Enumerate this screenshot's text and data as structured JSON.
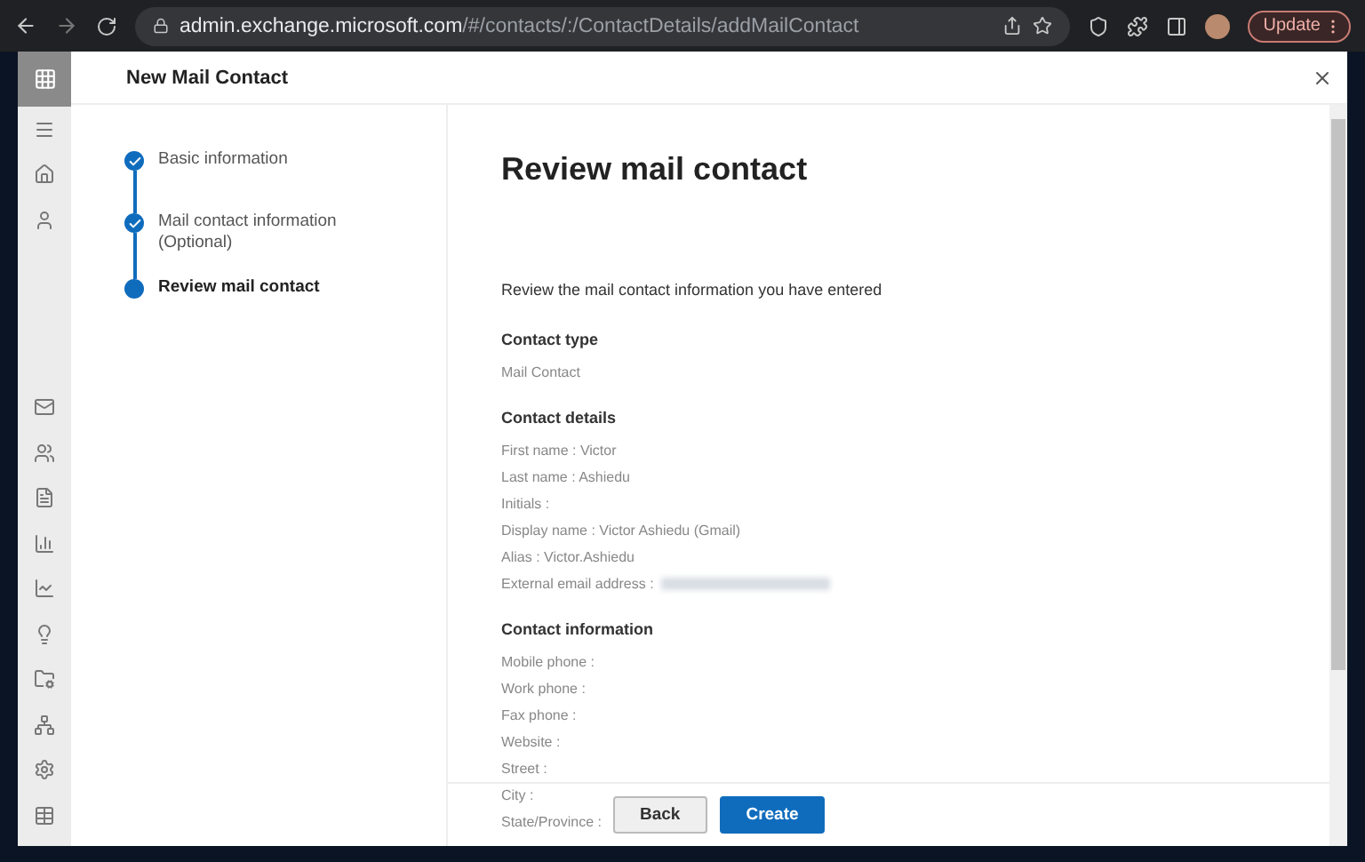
{
  "browser": {
    "url_host": "admin.exchange.microsoft.com",
    "url_path": "/#/contacts/:/ContactDetails/addMailContact",
    "update_label": "Update"
  },
  "panel": {
    "title": "New Mail Contact"
  },
  "steps": [
    {
      "label": "Basic information",
      "done": true,
      "selected": false
    },
    {
      "label": "Mail contact information (Optional)",
      "done": true,
      "selected": false
    },
    {
      "label": "Review mail contact",
      "done": false,
      "selected": true
    }
  ],
  "review": {
    "heading": "Review mail contact",
    "intro": "Review the mail contact information you have entered",
    "sections": [
      {
        "title": "Contact type",
        "rows": [
          {
            "text": "Mail Contact",
            "blurred_value": false
          }
        ]
      },
      {
        "title": "Contact details",
        "rows": [
          {
            "text": "First name : Victor",
            "blurred_value": false
          },
          {
            "text": "Last name : Ashiedu",
            "blurred_value": false
          },
          {
            "text": "Initials :",
            "blurred_value": false
          },
          {
            "text": "Display name : Victor Ashiedu (Gmail)",
            "blurred_value": false
          },
          {
            "text": "Alias : Victor.Ashiedu",
            "blurred_value": false
          },
          {
            "text": "External email address :",
            "blurred_value": true
          }
        ]
      },
      {
        "title": "Contact information",
        "rows": [
          {
            "text": "Mobile phone :",
            "blurred_value": false
          },
          {
            "text": "Work phone :",
            "blurred_value": false
          },
          {
            "text": "Fax phone :",
            "blurred_value": false
          },
          {
            "text": "Website :",
            "blurred_value": false
          },
          {
            "text": "Street :",
            "blurred_value": false
          },
          {
            "text": "City :",
            "blurred_value": false
          },
          {
            "text": "State/Province :",
            "blurred_value": false
          }
        ]
      }
    ]
  },
  "buttons": [
    {
      "label": "Back",
      "kind": "secondary"
    },
    {
      "label": "Create",
      "kind": "primary"
    }
  ]
}
